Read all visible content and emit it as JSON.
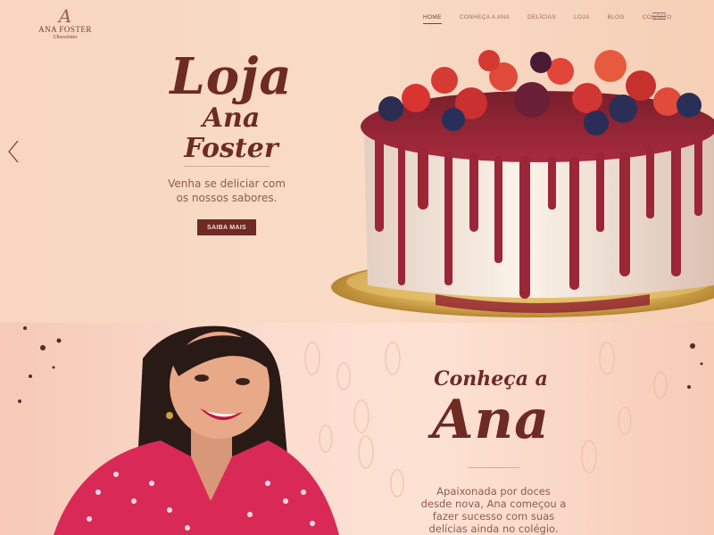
{
  "brand": {
    "logo_mark": "A",
    "name": "ANA FOSTER",
    "subtitle": "Chocolates"
  },
  "nav": {
    "items": [
      {
        "label": "HOME",
        "active": true
      },
      {
        "label": "CONHEÇA A ANA",
        "active": false
      },
      {
        "label": "DELÍCIAS",
        "active": false
      },
      {
        "label": "LOJA",
        "active": false
      },
      {
        "label": "BLOG",
        "active": false
      },
      {
        "label": "CONTATO",
        "active": false
      }
    ],
    "menu_icon": "hamburger-icon"
  },
  "hero": {
    "title_line1": "Loja",
    "title_line2": "Ana Foster",
    "text": "Venha se deliciar com os nossos sabores.",
    "cta_label": "SAIBA MAIS",
    "prev_icon": "chevron-left-icon"
  },
  "about": {
    "title_line1": "Conheça a",
    "title_line2": "Ana",
    "text": "Apaixonada por doces desde nova, Ana começou a fazer sucesso com suas delícias ainda no colégio. Hoje em dia, encanta o Brasil"
  },
  "colors": {
    "accent": "#6e2a24",
    "text_muted": "#8a5d52",
    "background": "#f8d6c0"
  }
}
